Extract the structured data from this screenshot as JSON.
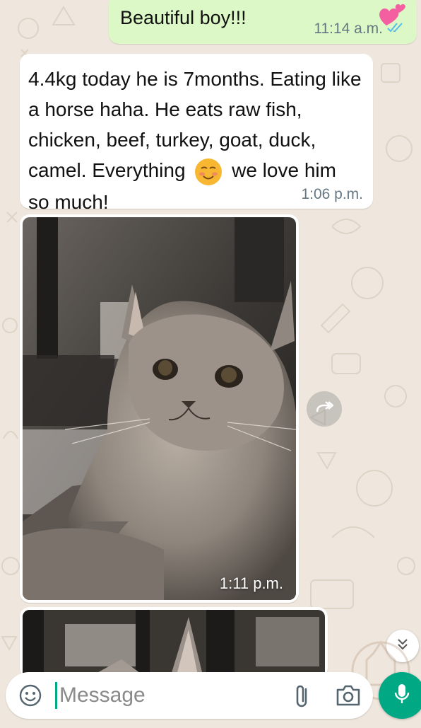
{
  "colors": {
    "chat_background": "#efe7dd",
    "outgoing_bubble": "#dcf8c6",
    "incoming_bubble": "#ffffff",
    "accent": "#00a884",
    "read_ticks": "#53bdeb"
  },
  "messages": [
    {
      "direction": "outgoing",
      "text": "Beautiful boy!!!",
      "emoji": "two-hearts-icon",
      "time": "11:14 a.m.",
      "status": "read-double-check-icon"
    },
    {
      "direction": "incoming",
      "text_part1": "4.4kg today he is 7months. Eating like a horse haha. He eats raw fish, chicken, beef, turkey, goat, duck, camel. Everything",
      "emoji": "smiling-face-icon",
      "text_part2": "we love him so much!",
      "time": "1:06 p.m."
    },
    {
      "direction": "incoming",
      "type": "photo",
      "subject": "grey-tabby-kitten",
      "time": "1:11 p.m."
    },
    {
      "direction": "incoming",
      "type": "photo",
      "subject": "grey-tabby-kitten-partial"
    }
  ],
  "buttons": {
    "forward": "forward-arrow-icon",
    "scroll_down": "double-chevron-down-icon"
  },
  "composer": {
    "placeholder": "Message",
    "emoji_icon": "emoji-face-icon",
    "attach_icon": "paperclip-icon",
    "camera_icon": "camera-icon",
    "mic_icon": "microphone-icon"
  }
}
